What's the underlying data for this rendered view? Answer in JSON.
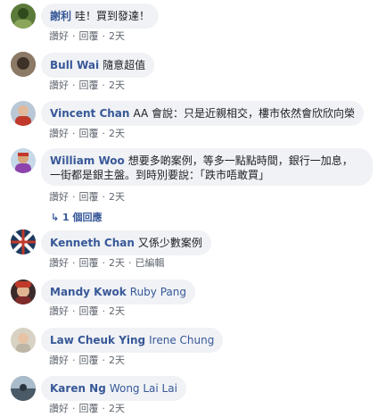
{
  "actions": {
    "like": "讚好",
    "reply": "回覆",
    "sep": "·",
    "edited": "已編輯"
  },
  "comments": [
    {
      "author": "謝利",
      "text": "哇！買到發達！",
      "time": "2天"
    },
    {
      "author": "Bull Wai",
      "text": "隨意超值",
      "time": "2天"
    },
    {
      "author": "Vincent Chan",
      "text": "AA 會說：只是近親相交，樓市依然會欣欣向榮",
      "time": "2天"
    },
    {
      "author": "William Woo",
      "text_line1": "想要多啲案例，等多一點點時間，銀行一加息，",
      "text_line2": "一街都是銀主盤。到時別要說：「跌市唔敢買」",
      "time": "2天"
    },
    {
      "author": "Kenneth Chan",
      "text": "又係少數案例",
      "time": "2天",
      "edited": true
    },
    {
      "author": "Mandy Kwok",
      "tag": "Ruby Pang",
      "time": "2天"
    },
    {
      "author": "Law Cheuk Ying",
      "tag": "Irene Chung",
      "time": "2天"
    },
    {
      "author": "Karen Ng",
      "tag": "Wong Lai Lai",
      "time": "2天"
    }
  ],
  "replies_link": "↳ 1 個回應"
}
